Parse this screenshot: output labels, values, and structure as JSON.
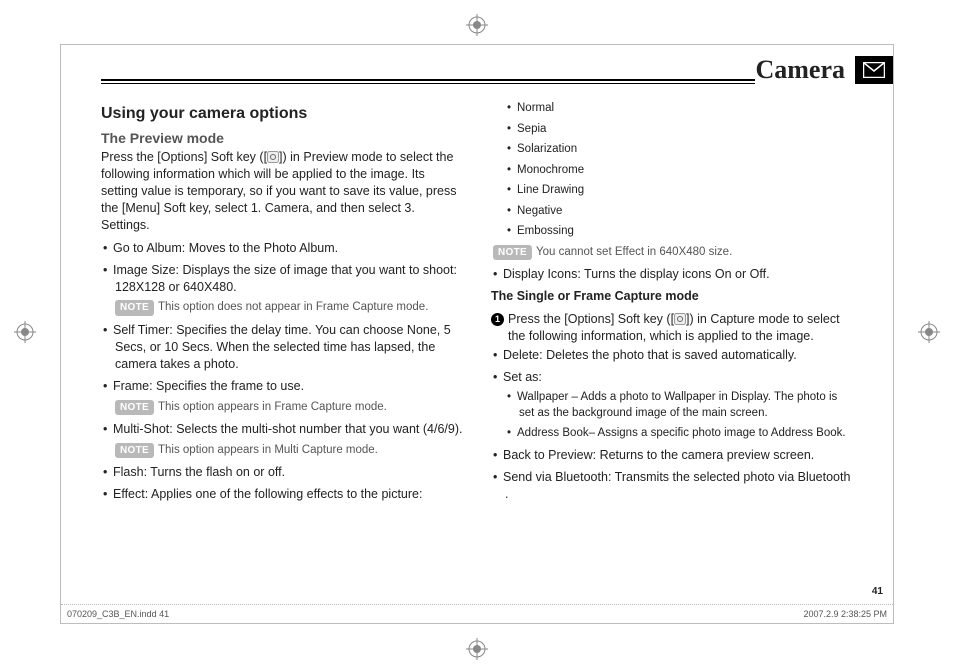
{
  "header": {
    "title": "Camera",
    "icon": "envelope-icon"
  },
  "left": {
    "h2": "Using your camera options",
    "h3": "The Preview mode",
    "intro_a": "Press the [Options] Soft key ([",
    "intro_b": "]) in Preview mode to select the following information which will be applied to the image. Its setting value is temporary, so if you want to save its value, press the [Menu] Soft key, select 1. Camera, and then select 3. Settings.",
    "li_goto": "Go to Album: Moves to the Photo Album.",
    "li_size": "Image Size: Displays the size of image that you want to shoot: 128X128 or 640X480.",
    "note1": "This option does not appear in Frame Capture mode.",
    "li_timer": "Self Timer: Specifies the delay time. You can choose None, 5 Secs, or 10 Secs. When the selected time has lapsed, the camera takes a photo.",
    "li_frame": "Frame: Specifies the frame to use.",
    "note2": "This option appears in Frame Capture mode.",
    "li_multi": "Multi-Shot: Selects the multi-shot number that you want (4/6/9).",
    "note3": "This option appears in Multi Capture mode.",
    "li_flash": "Flash: Turns the flash on or off.",
    "li_effect": "Effect: Applies one of the following effects to the picture:"
  },
  "right": {
    "eff1": "Normal",
    "eff2": "Sepia",
    "eff3": "Solarization",
    "eff4": "Monochrome",
    "eff5": "Line Drawing",
    "eff6": "Negative",
    "eff7": "Embossing",
    "note4": "You cannot set Effect in 640X480 size.",
    "li_display": "Display Icons: Turns the display icons On or Off.",
    "h_single": "The Single or Frame Capture mode",
    "step1_a": "Press the [Options] Soft key ([",
    "step1_b": "]) in Capture mode to select the following information, which is applied to the image.",
    "li_delete": "Delete: Deletes the photo that is saved automatically.",
    "li_setas": "Set as:",
    "setas_wall": "Wallpaper – Adds a photo to Wallpaper in Display. The photo is set as the background image of the main screen.",
    "setas_addr": "Address Book– Assigns a specific photo image to Address Book.",
    "li_back": "Back to Preview: Returns to the camera preview screen.",
    "li_bt": "Send via Bluetooth: Transmits the selected photo via Bluetooth ."
  },
  "note_label": "NOTE",
  "pagenum": "41",
  "footer": {
    "left": "070209_C3B_EN.indd   41",
    "right": "2007.2.9   2:38:25 PM"
  }
}
